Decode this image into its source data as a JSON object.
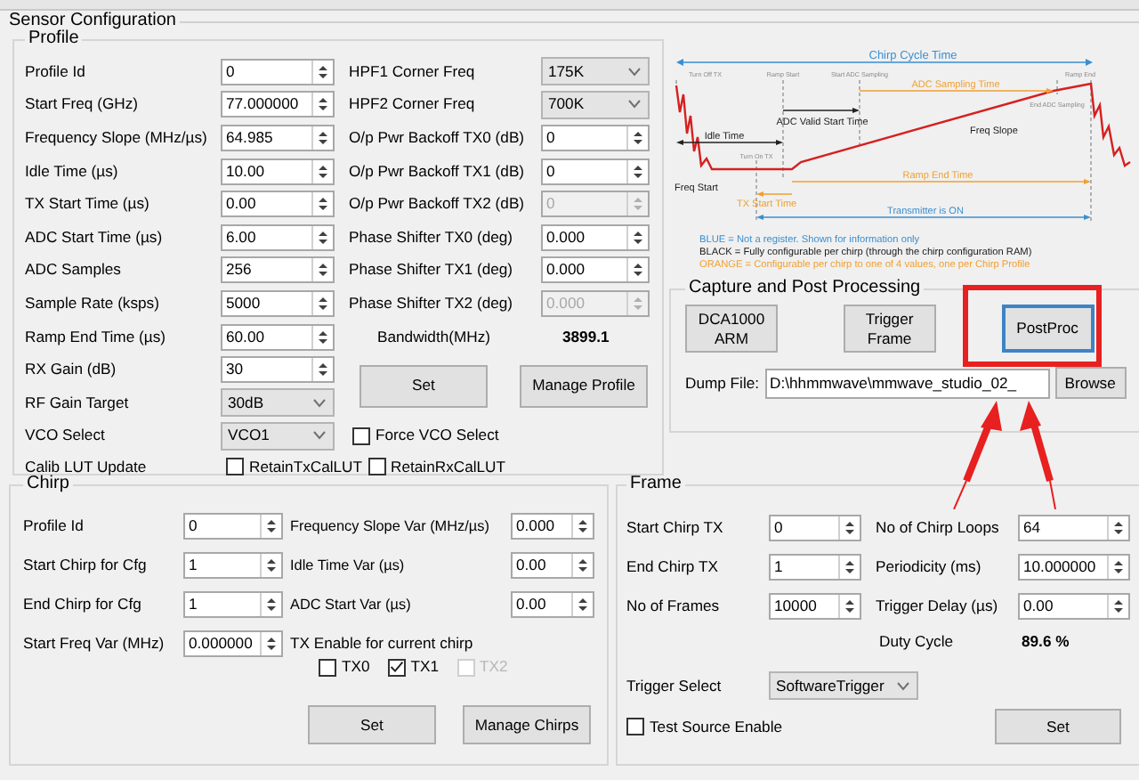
{
  "sensor_configuration": {
    "title": "Sensor Configuration",
    "profile": {
      "title": "Profile",
      "left_fields": [
        {
          "label": "Profile Id",
          "value": "0",
          "kind": "spin"
        },
        {
          "label": "Start Freq (GHz)",
          "value": "77.000000",
          "kind": "spin"
        },
        {
          "label": "Frequency Slope (MHz/µs)",
          "value": "64.985",
          "kind": "spin"
        },
        {
          "label": "Idle Time (µs)",
          "value": "10.00",
          "kind": "spin"
        },
        {
          "label": "TX Start Time (µs)",
          "value": "0.00",
          "kind": "spin"
        },
        {
          "label": "ADC Start Time (µs)",
          "value": "6.00",
          "kind": "spin"
        },
        {
          "label": "ADC Samples",
          "value": "256",
          "kind": "spin"
        },
        {
          "label": "Sample Rate (ksps)",
          "value": "5000",
          "kind": "spin"
        },
        {
          "label": "Ramp End Time (µs)",
          "value": "60.00",
          "kind": "spin"
        },
        {
          "label": "RX Gain (dB)",
          "value": "30",
          "kind": "spin"
        },
        {
          "label": "RF Gain Target",
          "value": "30dB",
          "kind": "select"
        },
        {
          "label": "VCO Select",
          "value": "VCO1",
          "kind": "select"
        }
      ],
      "right_fields": [
        {
          "label": "HPF1 Corner Freq",
          "value": "175K",
          "kind": "select",
          "disabled": false
        },
        {
          "label": "HPF2 Corner Freq",
          "value": "700K",
          "kind": "select",
          "disabled": false
        },
        {
          "label": "O/p Pwr Backoff TX0 (dB)",
          "value": "0",
          "kind": "spin",
          "disabled": false
        },
        {
          "label": "O/p Pwr Backoff TX1 (dB)",
          "value": "0",
          "kind": "spin",
          "disabled": false
        },
        {
          "label": "O/p Pwr Backoff TX2 (dB)",
          "value": "0",
          "kind": "spin",
          "disabled": true
        },
        {
          "label": "Phase Shifter TX0 (deg)",
          "value": "0.000",
          "kind": "spin",
          "disabled": false
        },
        {
          "label": "Phase Shifter TX1 (deg)",
          "value": "0.000",
          "kind": "spin",
          "disabled": false
        },
        {
          "label": "Phase Shifter TX2 (deg)",
          "value": "0.000",
          "kind": "spin",
          "disabled": true
        }
      ],
      "bandwidth": {
        "label": "Bandwidth(MHz)",
        "value": "3899.1"
      },
      "buttons": [
        "Set",
        "Manage Profile"
      ],
      "force_vco": {
        "label": "Force VCO Select",
        "checked": false
      },
      "calib_lut": {
        "label": "Calib LUT Update",
        "options": [
          {
            "label": "RetainTxCalLUT",
            "checked": false
          },
          {
            "label": "RetainRxCalLUT",
            "checked": false
          }
        ]
      }
    },
    "diagram": {
      "chirp_cycle_time": "Chirp Cycle Time",
      "turn_off_tx": "Turn Off TX",
      "ramp_start": "Ramp Start",
      "start_adc_sampling": "Start ADC Sampling",
      "ramp_end": "Ramp End",
      "adc_sampling_time": "ADC Sampling Time",
      "end_adc_sampling": "End ADC Sampling",
      "adc_valid_start_time": "ADC Valid Start Time",
      "freq_slope": "Freq Slope",
      "idle_time": "Idle Time",
      "turn_on_tx": "Turn On TX",
      "freq_start": "Freq Start",
      "ramp_end_time": "Ramp End Time",
      "tx_start_time": "TX Start Time",
      "transmitter_on": "Transmitter is ON",
      "legend": [
        {
          "text": "BLUE = Not a register. Shown for information only",
          "color": "#3a8fd0"
        },
        {
          "text": "BLACK = Fully configurable per chirp (through the chirp configuration RAM)",
          "color": "#202020"
        },
        {
          "text": "ORANGE = Configurable per chirp to one of 4 values, one per Chirp Profile",
          "color": "#f0a030"
        }
      ]
    },
    "capture": {
      "title": "Capture and Post Processing",
      "buttons": [
        {
          "label": "DCA1000 ARM",
          "focused": false
        },
        {
          "label": "Trigger Frame",
          "focused": false
        },
        {
          "label": "PostProc",
          "focused": true
        }
      ],
      "dump_file": {
        "label": "Dump File:",
        "value": "D:\\hhmmwave\\mmwave_studio_02_"
      },
      "browse": "Browse"
    }
  },
  "chirp": {
    "title": "Chirp",
    "left_fields": [
      {
        "label": "Profile Id",
        "value": "0"
      },
      {
        "label": "Start Chirp for Cfg",
        "value": "1"
      },
      {
        "label": "End Chirp for Cfg",
        "value": "1"
      },
      {
        "label": "Start Freq Var (MHz)",
        "value": "0.000000"
      }
    ],
    "right_fields": [
      {
        "label": "Frequency Slope Var (MHz/µs)",
        "value": "0.000"
      },
      {
        "label": "Idle Time Var (µs)",
        "value": "0.00"
      },
      {
        "label": "ADC Start Var (µs)",
        "value": "0.00"
      }
    ],
    "tx_enable": {
      "label": "TX Enable for current chirp",
      "options": [
        {
          "label": "TX0",
          "checked": false,
          "disabled": false
        },
        {
          "label": "TX1",
          "checked": true,
          "disabled": false
        },
        {
          "label": "TX2",
          "checked": false,
          "disabled": true
        }
      ]
    },
    "buttons": [
      "Set",
      "Manage Chirps"
    ]
  },
  "frame": {
    "title": "Frame",
    "left_fields": [
      {
        "label": "Start Chirp TX",
        "value": "0"
      },
      {
        "label": "End Chirp TX",
        "value": "1"
      },
      {
        "label": "No of Frames",
        "value": "10000"
      }
    ],
    "right_fields": [
      {
        "label": "No of Chirp Loops",
        "value": "64"
      },
      {
        "label": "Periodicity (ms)",
        "value": "10.000000"
      },
      {
        "label": "Trigger Delay (µs)",
        "value": "0.00"
      }
    ],
    "duty_cycle": {
      "label": "Duty Cycle",
      "value": "89.6 %"
    },
    "trigger_select": {
      "label": "Trigger Select",
      "value": "SoftwareTrigger"
    },
    "test_source": {
      "label": "Test Source Enable",
      "checked": false
    },
    "button": "Set"
  }
}
